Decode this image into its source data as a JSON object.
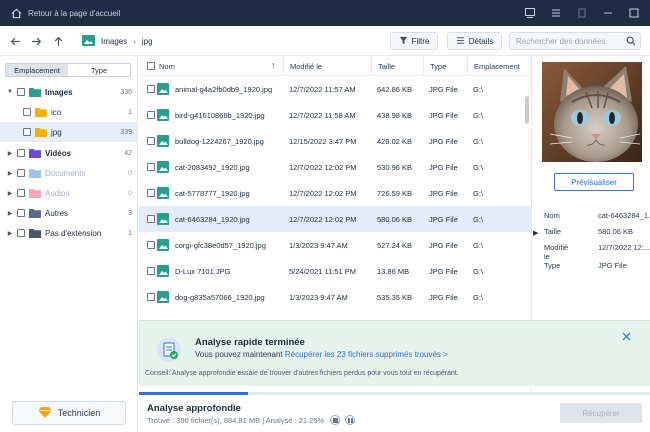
{
  "titlebar": {
    "title": "Retour à la page d'accueil"
  },
  "toolbar": {
    "breadcrumbs": [
      "Images",
      "jpg"
    ],
    "filter_label": "Filtre",
    "details_label": "Détails",
    "search_placeholder": "Rechercher des données"
  },
  "leftpane": {
    "tab_location": "Emplacement",
    "tab_type": "Type",
    "tree": [
      {
        "label": "Images",
        "count": "336",
        "expanded": true,
        "bold": true,
        "color": "#2a9d8f"
      },
      {
        "label": "ico",
        "count": "1",
        "indent": true,
        "color": "#f5b301"
      },
      {
        "label": "jpg",
        "count": "339",
        "indent": true,
        "selected": true,
        "color": "#f5b301"
      },
      {
        "label": "Vidéos",
        "count": "42",
        "bold": true,
        "color": "#6c4bd8"
      },
      {
        "label": "Documents",
        "count": "0",
        "dim": true,
        "color": "#9ec3f0"
      },
      {
        "label": "Audios",
        "count": "0",
        "dim": true,
        "color": "#f3a6b8"
      },
      {
        "label": "Autres",
        "count": "3",
        "color": "#5b6b86"
      },
      {
        "label": "Pas d'extension",
        "count": "1",
        "color": "#4a5668"
      }
    ],
    "technician_label": "Technicien"
  },
  "list": {
    "columns": {
      "name": "Nom",
      "modified": "Modifié le",
      "size": "Taille",
      "type": "Type",
      "location": "Emplacement"
    },
    "rows": [
      {
        "name": "animal-g4a2fb0db9_1920.jpg",
        "modified": "12/7/2022 11:57 AM",
        "size": "642.86 KB",
        "type": "JPG File",
        "location": "G:\\"
      },
      {
        "name": "bird-g41610866b_1920.jpg",
        "modified": "12/7/2022 11:58 AM",
        "size": "438.98 KB",
        "type": "JPG File",
        "location": "G:\\"
      },
      {
        "name": "bulldog-1224267_1920.jpg",
        "modified": "12/15/2022 3:47 PM",
        "size": "428.02 KB",
        "type": "JPG File",
        "location": "G:\\"
      },
      {
        "name": "cat-2083492_1920.jpg",
        "modified": "12/7/2022 12:02 PM",
        "size": "530.96 KB",
        "type": "JPG File",
        "location": "G:\\"
      },
      {
        "name": "cat-5778777_1920.jpg",
        "modified": "12/7/2022 12:02 PM",
        "size": "726.59 KB",
        "type": "JPG File",
        "location": "G:\\"
      },
      {
        "name": "cat-6463284_1920.jpg",
        "modified": "12/7/2022 12:02 PM",
        "size": "580.06 KB",
        "type": "JPG File",
        "location": "G:\\",
        "selected": true
      },
      {
        "name": "corgi-gfc38e0d57_1920.jpg",
        "modified": "1/3/2023 9:47 AM",
        "size": "527.24 KB",
        "type": "JPG File",
        "location": "G:\\"
      },
      {
        "name": "D-Lux 7101.JPG",
        "modified": "5/24/2021 11:51 PM",
        "size": "13.86 MB",
        "type": "JPG File",
        "location": "G:\\"
      },
      {
        "name": "dog-g835a57066_1920.jpg",
        "modified": "1/3/2023 9:47 AM",
        "size": "535.35 KB",
        "type": "JPG File",
        "location": "G:\\"
      }
    ]
  },
  "details": {
    "preview_button": "Prévisualiser",
    "fields": [
      {
        "key": "Nom",
        "value": "cat-6463284_1..."
      },
      {
        "key": "Taille",
        "value": "580.06 KB"
      },
      {
        "key": "Modifié le",
        "value": "12/7/2022 12:..."
      },
      {
        "key": "Type",
        "value": "JPG File"
      }
    ]
  },
  "toast": {
    "title": "Analyse rapide terminée",
    "text_prefix": "Vous pouvez maintenant",
    "link": "Récupérer les 23 fichiers supprimés trouvés >",
    "tip": "Conseil: Analyse approfondie essaie de trouver d'autres fichiers perdus pour vous tout en récupérant."
  },
  "bottom": {
    "title": "Analyse approfondie",
    "status": "Trouvé : 390 fichier(s), 884.81 MB | Analysé : 21.25%",
    "progress": 0.2125,
    "recover_label": "Récupérer"
  },
  "colors": {
    "accent": "#2e6fdc",
    "titlebar": "#1f2c45",
    "success": "#e6f3ec"
  }
}
